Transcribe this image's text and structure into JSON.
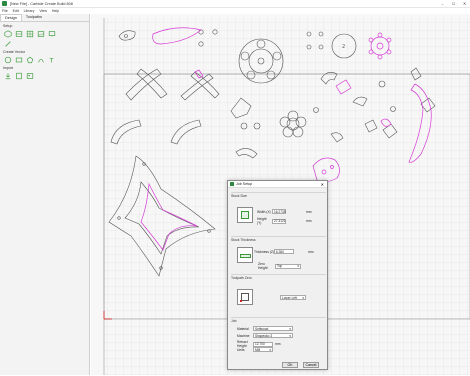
{
  "app": {
    "title": "[New File] - Carbide Create Build 808",
    "window_controls": [
      "–",
      "☐",
      "✕"
    ]
  },
  "menu": [
    "File",
    "Edit",
    "Library",
    "View",
    "Help"
  ],
  "panel": {
    "tabs": [
      "Design",
      "Toolpaths"
    ],
    "sections": {
      "setup": "Setup",
      "create_vector": "Create Vector",
      "import": "Import"
    }
  },
  "dialog": {
    "title": "Job Setup",
    "close": "✕",
    "stock_size": {
      "label": "Stock Size",
      "width_label": "Width (X)",
      "width_value": "16.2735",
      "height_label": "Height (Y)",
      "height_value": "27.3121",
      "unit": "mm"
    },
    "stock_thickness": {
      "label": "Stock Thickness",
      "thickness_label": "Thickness (Z)",
      "thickness_value": "6.350",
      "unit": "mm",
      "zero_height_label": "Zero Height",
      "zero_height_value": "Top"
    },
    "toolpath_zero": {
      "label": "Toolpath Zero",
      "value": "Lower Left"
    },
    "job": {
      "label": "Job",
      "material_label": "Material",
      "material_value": "Softwood",
      "machine_label": "Machine",
      "machine_value": "Shapeoko 3",
      "retract_label": "Retract Height",
      "retract_value": "12.700",
      "retract_unit": "mm",
      "units_label": "Units",
      "units_value": "MM"
    },
    "ok": "OK",
    "cancel": "Cancel"
  }
}
